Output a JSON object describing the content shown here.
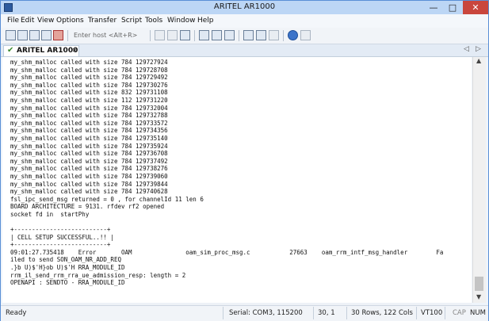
{
  "window": {
    "title": "ARITEL AR1000"
  },
  "menu": [
    "File",
    "Edit",
    "View",
    "Options",
    "Transfer",
    "Script",
    "Tools",
    "Window",
    "Help"
  ],
  "toolbar": {
    "host_placeholder": "Enter host <Alt+R>"
  },
  "tab": {
    "label": "ARITEL AR1000"
  },
  "terminal": {
    "lines": [
      "my_shm_malloc called with size 784 129727924",
      "my_shm_malloc called with size 784 129728708",
      "my_shm_malloc called with size 784 129729492",
      "my_shm_malloc called with size 784 129730276",
      "my_shm_malloc called with size 832 129731108",
      "my_shm_malloc called with size 112 129731220",
      "my_shm_malloc called with size 784 129732004",
      "my_shm_malloc called with size 784 129732788",
      "my_shm_malloc called with size 784 129733572",
      "my_shm_malloc called with size 784 129734356",
      "my_shm_malloc called with size 784 129735140",
      "my_shm_malloc called with size 784 129735924",
      "my_shm_malloc called with size 784 129736708",
      "my_shm_malloc called with size 784 129737492",
      "my_shm_malloc called with size 784 129738276",
      "my_shm_malloc called with size 784 129739060",
      "my_shm_malloc called with size 784 129739844",
      "my_shm_malloc called with size 784 129740628",
      "fsl_ipc_send_msg returned = 0 , for channelId 11 len 6",
      "BOARD ARCHITECTURE = 9131. rfdev rf2 opened",
      "socket fd in  startPhy",
      "",
      "+--------------------------+",
      "| CELL SETUP SUCCESSFUL..!! |",
      "+--------------------------+",
      "09:01:27.735418    Error       OAM               oam_sim_proc_msg.c           27663    oam_rrm_intf_msg_handler        Fa",
      "iled to send SON_OAM_NR_ADD_REQ",
      ".}b U)$'H}ob U)$'H RRA_MODULE_ID",
      "rrm_il_send_rrm_rra_ue_admission_resp: length = 2",
      "OPENAPI : SENDTO - RRA_MODULE_ID"
    ]
  },
  "status": {
    "ready": "Ready",
    "serial": "Serial: COM3, 115200",
    "position": "30,   1",
    "size": "30 Rows, 122 Cols",
    "emulation": "VT100",
    "caps": "CAP",
    "num": "NUM"
  }
}
